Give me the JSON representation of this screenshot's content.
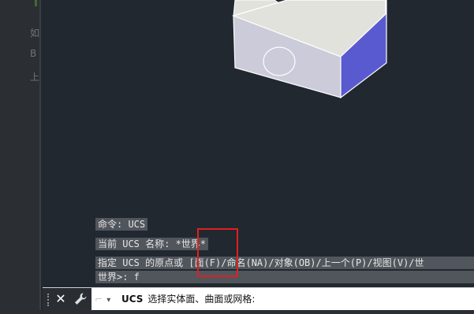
{
  "left_panel": {
    "fragments": [
      "如",
      "B",
      "上"
    ]
  },
  "history": {
    "line1": "命令: UCS",
    "line2": "当前 UCS 名称: *世界*",
    "line3": "指定 UCS 的原点或 [面(F)/命名(NA)/对象(OB)/上一个(P)/视图(V)/世",
    "line4": "世界>: f"
  },
  "command_line": {
    "close_symbol": "✕",
    "recent_symbol": "▾",
    "command_name": "UCS",
    "prompt": "选择实体面、曲面或网格:"
  },
  "colors": {
    "viewport_bg": "#212830",
    "box_top": "#e2e2dc",
    "box_front": "#cbcbd9",
    "box_side": "#5a5ad0",
    "highlight": "#e02020"
  },
  "icons": {
    "close": "close-icon",
    "customize": "wrench-icon",
    "recent": "chevron-down-icon"
  }
}
